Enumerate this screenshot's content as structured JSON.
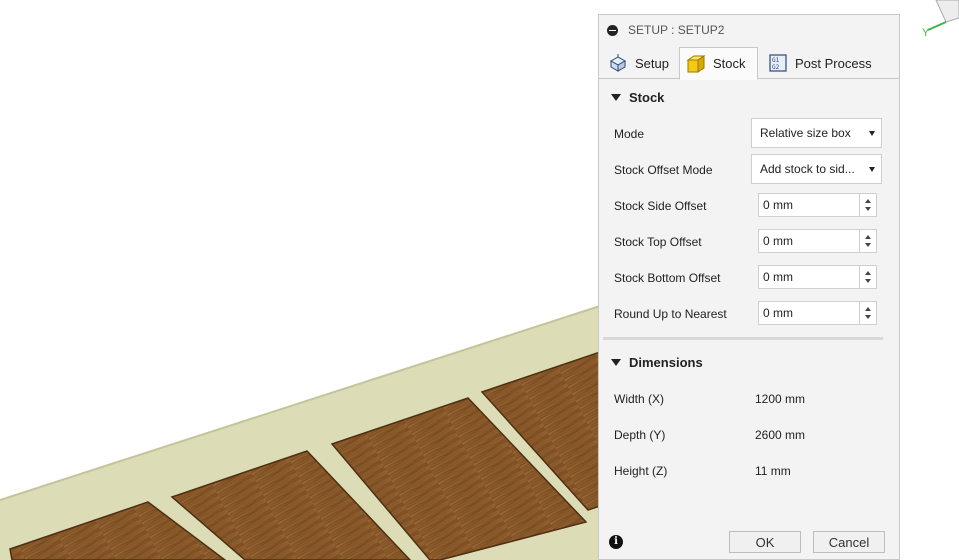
{
  "dialog": {
    "title": "SETUP : SETUP2",
    "tabs": [
      {
        "label": "Setup",
        "icon": "setup-icon",
        "active": false
      },
      {
        "label": "Stock",
        "icon": "stock-box-icon",
        "active": true
      },
      {
        "label": "Post Process",
        "icon": "post-process-icon",
        "active": false
      }
    ],
    "stock_group": {
      "header": "Stock",
      "mode": {
        "label": "Mode",
        "value": "Relative size box"
      },
      "offset_mode": {
        "label": "Stock Offset Mode",
        "value": "Add stock to sid..."
      },
      "side_offset": {
        "label": "Stock Side Offset",
        "value": "0 mm"
      },
      "top_offset": {
        "label": "Stock Top Offset",
        "value": "0 mm"
      },
      "bottom_offset": {
        "label": "Stock Bottom Offset",
        "value": "0 mm"
      },
      "round_up": {
        "label": "Round Up to Nearest",
        "value": "0 mm"
      }
    },
    "dimensions_group": {
      "header": "Dimensions",
      "width": {
        "label": "Width (X)",
        "value": "1200 mm"
      },
      "depth": {
        "label": "Depth (Y)",
        "value": "2600 mm"
      },
      "height": {
        "label": "Height (Z)",
        "value": "11 mm"
      }
    },
    "buttons": {
      "ok": "OK",
      "cancel": "Cancel"
    }
  },
  "viewport": {
    "triad_label": "Y",
    "colors": {
      "board": "#dcdcb6",
      "wood": "#8a5a2b",
      "triad_green": "#3cb44b"
    }
  }
}
